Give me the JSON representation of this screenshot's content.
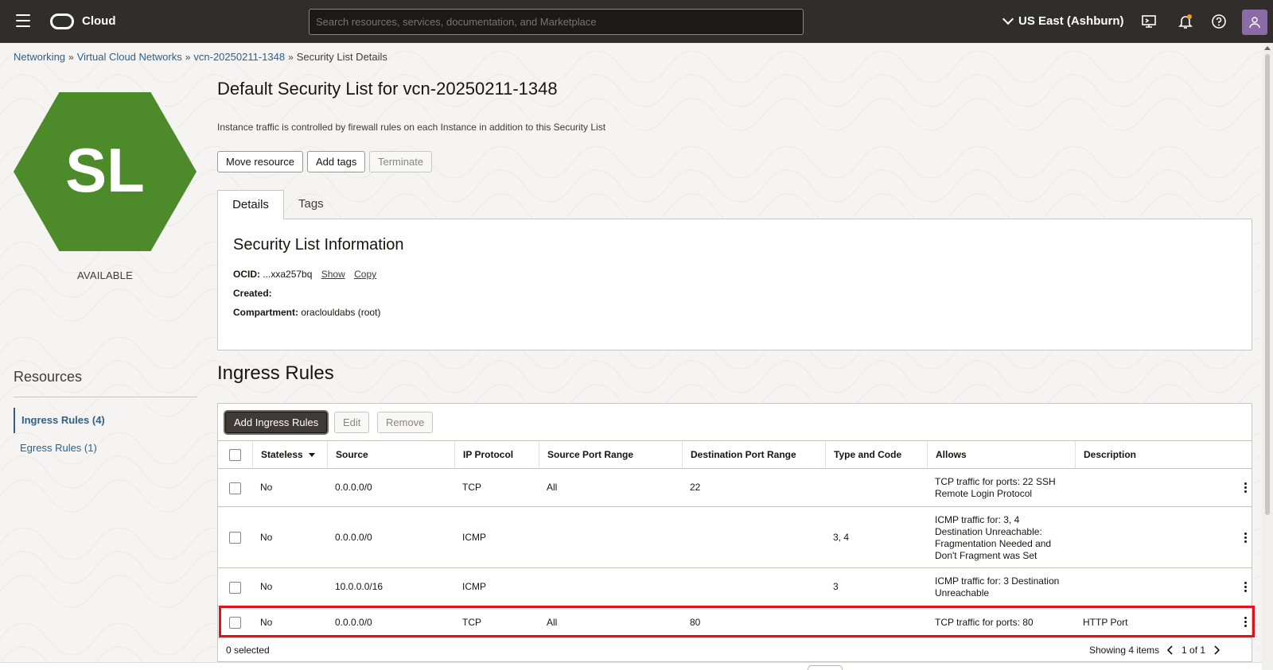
{
  "topbar": {
    "brand": "Cloud",
    "search_placeholder": "Search resources, services, documentation, and Marketplace",
    "region": "US East (Ashburn)"
  },
  "breadcrumb": [
    {
      "label": "Networking",
      "sep": "»"
    },
    {
      "label": "Virtual Cloud Networks",
      "sep": "»"
    },
    {
      "label": "vcn-20250211-1348",
      "sep": "»"
    },
    {
      "label": "Security List Details"
    }
  ],
  "left": {
    "hex_label": "SL",
    "hex_color": "#4d8b2a",
    "status": "AVAILABLE",
    "resources_title": "Resources",
    "resources": [
      {
        "label": "Ingress Rules (4)"
      },
      {
        "label": "Egress Rules (1)"
      }
    ]
  },
  "page": {
    "title": "Default Security List for vcn-20250211-1348",
    "description": "Instance traffic is controlled by firewall rules on each Instance in addition to this Security List",
    "actions": {
      "move": "Move resource",
      "tags": "Add tags",
      "terminate": "Terminate"
    },
    "tabs": {
      "details": "Details",
      "tags": "Tags"
    }
  },
  "info": {
    "title": "Security List Information",
    "ocid_label": "OCID:",
    "ocid_value": "...xxa257bq",
    "show": "Show",
    "copy": "Copy",
    "created_label": "Created:",
    "created_value": "",
    "compartment_label": "Compartment:",
    "compartment_value": "oraclouldabs (root)"
  },
  "ingress": {
    "title": "Ingress Rules",
    "buttons": {
      "add": "Add Ingress Rules",
      "edit": "Edit",
      "remove": "Remove"
    },
    "columns": [
      "Stateless",
      "Source",
      "IP Protocol",
      "Source Port Range",
      "Destination Port Range",
      "Type and Code",
      "Allows",
      "Description"
    ],
    "rows": [
      {
        "stateless": "No",
        "source": "0.0.0.0/0",
        "protocol": "TCP",
        "source_port": "All",
        "dest_port": "22",
        "type_code": "",
        "allows": "TCP traffic for ports: 22 SSH Remote Login Protocol",
        "description": ""
      },
      {
        "stateless": "No",
        "source": "0.0.0.0/0",
        "protocol": "ICMP",
        "source_port": "",
        "dest_port": "",
        "type_code": "3, 4",
        "allows": "ICMP traffic for: 3, 4 Destination Unreachable: Fragmentation Needed and Don't Fragment was Set",
        "description": ""
      },
      {
        "stateless": "No",
        "source": "10.0.0.0/16",
        "protocol": "ICMP",
        "source_port": "",
        "dest_port": "",
        "type_code": "3",
        "allows": "ICMP traffic for: 3 Destination Unreachable",
        "description": ""
      },
      {
        "stateless": "No",
        "source": "0.0.0.0/0",
        "protocol": "TCP",
        "source_port": "All",
        "dest_port": "80",
        "type_code": "",
        "allows": "TCP traffic for ports: 80",
        "description": "HTTP Port"
      }
    ],
    "selected": "0 selected",
    "showing": "Showing 4 items",
    "page": "1 of 1"
  },
  "colors": {
    "topbar": "#312d2a",
    "highlight": "#e0121f",
    "link": "#2f5f86"
  }
}
